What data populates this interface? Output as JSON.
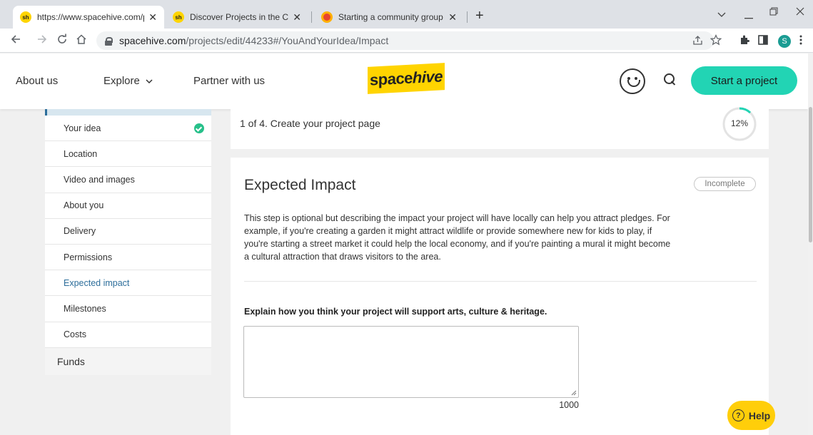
{
  "browser": {
    "tabs": [
      {
        "title": "https://www.spacehive.com/proje",
        "favicon": "sh"
      },
      {
        "title": "Discover Projects in the Crowdfu",
        "favicon": "sh"
      },
      {
        "title": "Starting a community group guid",
        "favicon": "red-circle"
      }
    ],
    "tab_close": "✕",
    "new_tab": "+",
    "url_host": "spacehive.com",
    "url_path": "/projects/edit/44233#/YouAndYourIdea/Impact",
    "profile_initial": "S"
  },
  "header": {
    "nav": [
      "About us",
      "Explore",
      "Partner with us"
    ],
    "explore_caret": "⌄",
    "logo_text_plain": "space",
    "logo_text_italic": "hive",
    "start_button": "Start a project",
    "accent_color": "#22d4b4"
  },
  "sidebar": {
    "items": [
      {
        "label": "Your idea",
        "complete": true
      },
      {
        "label": "Location"
      },
      {
        "label": "Video and images"
      },
      {
        "label": "About you"
      },
      {
        "label": "Delivery"
      },
      {
        "label": "Permissions"
      },
      {
        "label": "Expected impact",
        "active": true
      },
      {
        "label": "Milestones"
      },
      {
        "label": "Costs"
      }
    ],
    "funds": "Funds"
  },
  "step": {
    "text": "1 of 4. Create your project page",
    "progress_label": "12%",
    "progress_value": 0.12
  },
  "impact": {
    "title": "Expected Impact",
    "status": "Incomplete",
    "description": "This step is optional but describing the impact your project will have locally can help you attract pledges. For example, if you're creating a garden it might attract wildlife or provide somewhere new for kids to play, if you're starting a street market it could help the local economy, and if you're painting a mural it might become a cultural attraction that draws visitors to the area.",
    "question": "Explain how you think your project will support arts, culture & heritage.",
    "answer": "",
    "char_limit": "1000"
  },
  "help": {
    "label": "Help",
    "icon_glyph": "?"
  }
}
